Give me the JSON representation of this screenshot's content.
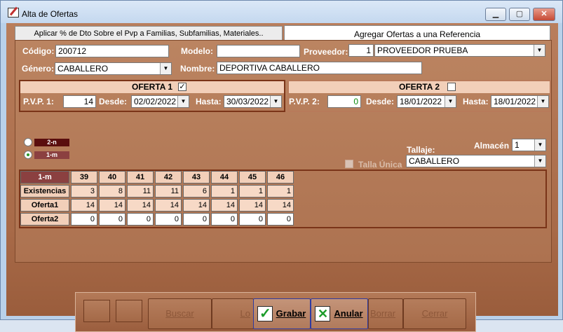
{
  "window": {
    "title": "Alta de Ofertas",
    "min": "▁",
    "max": "▢",
    "close": "✕"
  },
  "tabs": [
    {
      "label": "Aplicar % de Dto Sobre el Pvp a Familias, Subfamilias, Materiales.."
    },
    {
      "label": "Agregar Ofertas a una Referencia"
    }
  ],
  "form": {
    "codigo_label": "Código:",
    "codigo_value": "200712",
    "modelo_label": "Modelo:",
    "modelo_value": "",
    "proveedor_label": "Proveedor:",
    "proveedor_num": "1",
    "proveedor_name": "PROVEEDOR PRUEBA",
    "genero_label": "Género:",
    "genero_value": "CABALLERO",
    "nombre_label": "Nombre:",
    "nombre_value": "DEPORTIVA CABALLERO"
  },
  "oferta1": {
    "title": "OFERTA 1",
    "checked": "✓",
    "pvp_label": "P.V.P. 1:",
    "pvp_value": "14",
    "desde_label": "Desde:",
    "desde_value": "02/02/2022",
    "hasta_label": "Hasta:",
    "hasta_value": "30/03/2022"
  },
  "oferta2": {
    "title": "OFERTA 2",
    "checked": "",
    "pvp_label": "P.V.P. 2:",
    "pvp_value": "0",
    "desde_label": "Desde:",
    "desde_value": "18/01/2022",
    "hasta_label": "Hasta:",
    "hasta_value": "18/01/2022"
  },
  "options": {
    "radio1": "2-n",
    "radio2": "1-m",
    "almacen_label": "Almacén",
    "almacen_value": "1",
    "tallaje_label": "Tallaje:",
    "tallaje_value": "CABALLERO",
    "talla_unica_label": "Talla Única"
  },
  "grid": {
    "corner": "1-m",
    "sizes": [
      "39",
      "40",
      "41",
      "42",
      "43",
      "44",
      "45",
      "46"
    ],
    "rows": [
      {
        "label": "Existencias",
        "values": [
          "3",
          "8",
          "11",
          "11",
          "6",
          "1",
          "1",
          "1"
        ]
      },
      {
        "label": "Oferta1",
        "values": [
          "14",
          "14",
          "14",
          "14",
          "14",
          "14",
          "14",
          "14"
        ]
      },
      {
        "label": "Oferta2",
        "values": [
          "0",
          "0",
          "0",
          "0",
          "0",
          "0",
          "0",
          "0"
        ]
      }
    ]
  },
  "buttons": {
    "buscar": "Buscar",
    "lo": "Lo",
    "grabar": "Grabar",
    "anular": "Anular",
    "borrar": "Borrar",
    "cerrar": "Cerrar"
  },
  "colors": {
    "panel": "#ad7250",
    "header_cell": "#f2cfb9",
    "frame": "#7a3418",
    "accent_green": "#1c9c2a"
  }
}
